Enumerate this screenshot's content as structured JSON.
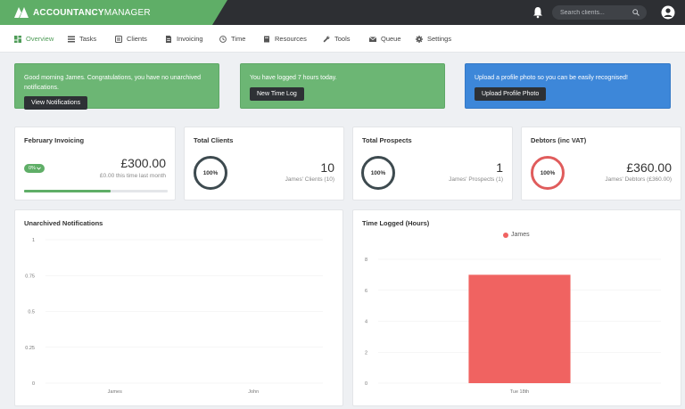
{
  "header": {
    "brand_bold": "ACCOUNTANCY",
    "brand_thin": "MANAGER",
    "search_placeholder": "Search clients..."
  },
  "nav": [
    {
      "label": "Overview",
      "icon": "dashboard-icon",
      "active": true
    },
    {
      "label": "Tasks",
      "icon": "list-icon"
    },
    {
      "label": "Clients",
      "icon": "clients-icon"
    },
    {
      "label": "Invoicing",
      "icon": "invoice-icon"
    },
    {
      "label": "Time",
      "icon": "clock-icon"
    },
    {
      "label": "Resources",
      "icon": "book-icon"
    },
    {
      "label": "Tools",
      "icon": "wrench-icon"
    },
    {
      "label": "Queue",
      "icon": "mail-icon"
    },
    {
      "label": "Settings",
      "icon": "gear-icon"
    }
  ],
  "banners": {
    "notifications": {
      "text": "Good morning James. Congratulations, you have no unarchived notifications.",
      "button": "View Notifications"
    },
    "time": {
      "text": "You have logged 7 hours today.",
      "button": "New Time Log"
    },
    "photo": {
      "text": "Upload a profile photo so you can be easily recognised!",
      "button": "Upload Profile Photo"
    }
  },
  "stats": {
    "invoicing": {
      "title": "February Invoicing",
      "badge": "0%",
      "value": "£300.00",
      "sub": "£0.00 this time last month",
      "progress": 0.6
    },
    "clients": {
      "title": "Total Clients",
      "ring": "100%",
      "value": "10",
      "sub": "James' Clients (10)"
    },
    "prospects": {
      "title": "Total Prospects",
      "ring": "100%",
      "value": "1",
      "sub": "James' Prospects (1)"
    },
    "debtors": {
      "title": "Debtors (inc VAT)",
      "ring": "100%",
      "value": "£360.00",
      "sub": "James' Debtors (£360.00)"
    }
  },
  "colors": {
    "green": "#6cb674",
    "blue": "#3d87d9",
    "dark": "#2d2f33",
    "red": "#f06361"
  },
  "chart_data": [
    {
      "type": "bar",
      "title": "Unarchived Notifications",
      "categories": [
        "James",
        "John"
      ],
      "values": [
        0,
        0
      ],
      "yticks": [
        "1",
        "0.75",
        "0.5",
        "0.25",
        "0"
      ],
      "ylim": [
        0,
        1
      ],
      "grid": true
    },
    {
      "type": "bar",
      "title": "Time Logged (Hours)",
      "categories": [
        "Tue 18th"
      ],
      "series": [
        {
          "name": "James",
          "values": [
            7
          ],
          "color": "#f06361"
        }
      ],
      "yticks": [
        "8",
        "6",
        "4",
        "2",
        "0"
      ],
      "ylim": [
        0,
        8
      ],
      "legend": "top-center",
      "grid": true
    }
  ]
}
